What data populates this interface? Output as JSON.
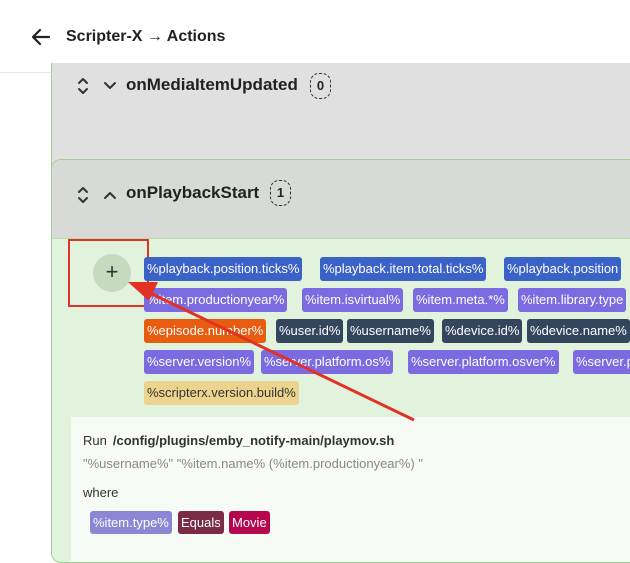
{
  "header": {
    "title": "Scripter-X → Actions"
  },
  "events": [
    {
      "name": "onMediaItemUpdated",
      "count": "0"
    },
    {
      "name": "onPlaybackStart",
      "count": "1"
    }
  ],
  "add_button": {
    "label": "+"
  },
  "variables": [
    "%playback.position.ticks%",
    "%playback.item.total.ticks%",
    "%playback.position",
    "%item.productionyear%",
    "%item.isvirtual%",
    "%item.meta.*%",
    "%item.library.type",
    "%episode.number%",
    "%user.id%",
    "%username%",
    "%device.id%",
    "%device.name%",
    "%server.version%",
    "%server.platform.os%",
    "%server.platform.osver%",
    "%server.p",
    "%scripterx.version.build%"
  ],
  "action": {
    "run_label": "Run",
    "script_path": "/config/plugins/emby_notify-main/playmov.sh",
    "args": "\"%username%\" \"%item.name% (%item.productionyear%) \"",
    "where_label": "where",
    "condition": {
      "variable": "%item.type%",
      "operator": "Equals",
      "value": "Movie"
    }
  },
  "colors": {
    "accent_red": "#e23125",
    "card_border": "#9ed38f",
    "tag_blue": "#3b63c7"
  }
}
